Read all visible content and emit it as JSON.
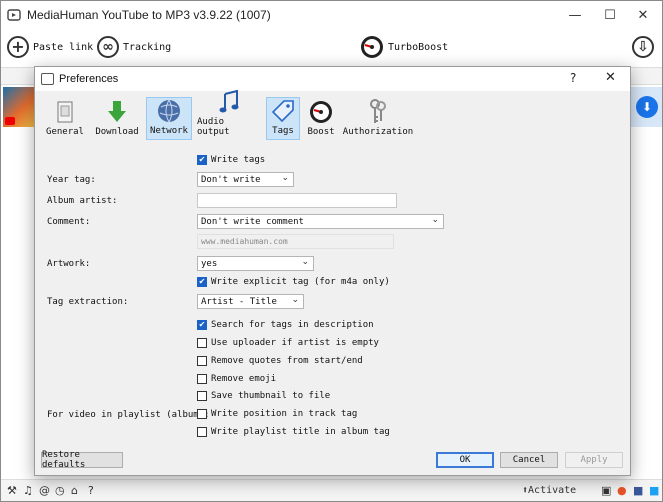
{
  "app": {
    "title": "MediaHuman YouTube to MP3 v3.9.22 (1007)",
    "window_controls": {
      "minimize": "—",
      "maximize": "☐",
      "close": "✕"
    }
  },
  "toolbar": {
    "paste_link": "Paste link",
    "tracking": "Tracking",
    "turboboost": "TurboBoost",
    "paste_icon": "+",
    "tracking_icon": "∞",
    "download_icon": "⇩"
  },
  "list": {
    "thumb_badge": "2"
  },
  "statusbar": {
    "activate": "Activate",
    "icons": [
      "wrench-icon",
      "music-note-icon",
      "snail-icon",
      "clock-icon",
      "home-icon",
      "help-icon"
    ],
    "social_icons": [
      "store-icon",
      "reddit-icon",
      "facebook-icon",
      "twitter-icon"
    ]
  },
  "dialog": {
    "title": "Preferences",
    "help": "?",
    "close": "✕",
    "tabs": [
      {
        "label": "General",
        "icon": "general-icon"
      },
      {
        "label": "Download",
        "icon": "download-arrow-icon"
      },
      {
        "label": "Network",
        "icon": "globe-icon"
      },
      {
        "label": "Audio output",
        "icon": "music-notes-icon"
      },
      {
        "label": "Tags",
        "icon": "tag-icon",
        "active": true
      },
      {
        "label": "Boost",
        "icon": "gauge-icon"
      },
      {
        "label": "Authorization",
        "icon": "keys-icon"
      }
    ],
    "tags": {
      "write_tags": "Write tags",
      "year_tag_label": "Year tag:",
      "year_tag_value": "Don't write",
      "album_artist_label": "Album artist:",
      "album_artist_value": "",
      "comment_label": "Comment:",
      "comment_value": "Don't write comment",
      "comment_text": "www.mediahuman.com",
      "artwork_label": "Artwork:",
      "artwork_value": "yes",
      "write_explicit": "Write explicit tag (for m4a only)",
      "tag_extraction_label": "Tag extraction:",
      "tag_extraction_value": "Artist - Title",
      "search_description": "Search for tags in description",
      "use_uploader": "Use uploader if artist is empty",
      "remove_quotes": "Remove quotes from start/end",
      "remove_emoji": "Remove emoji",
      "save_thumbnail": "Save thumbnail to file",
      "playlist_label": "For video in playlist (album):",
      "write_position": "Write position in track tag",
      "write_playlist_title": "Write playlist title in album tag",
      "checked": {
        "write_tags": true,
        "write_explicit": true,
        "search_description": true,
        "use_uploader": false,
        "remove_quotes": false,
        "remove_emoji": false,
        "save_thumbnail": false,
        "write_position": false,
        "write_playlist_title": false
      }
    },
    "buttons": {
      "restore_defaults": "Restore defaults",
      "ok": "OK",
      "cancel": "Cancel",
      "apply": "Apply"
    }
  },
  "colors": {
    "accent": "#1a62c8",
    "tab_active": "#cce4f7",
    "dialog_bg": "#f0f0f0"
  }
}
